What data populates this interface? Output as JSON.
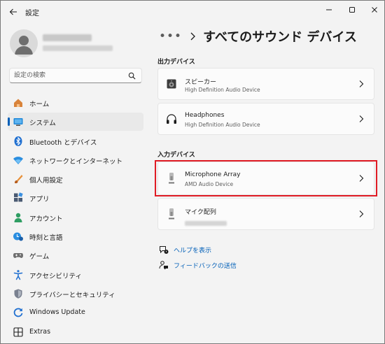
{
  "window": {
    "title": "設定",
    "controls": [
      "minimize-icon",
      "maximize-icon",
      "close-icon"
    ]
  },
  "profile": {
    "name": "",
    "email": ""
  },
  "search": {
    "placeholder": "設定の検索",
    "value": ""
  },
  "sidebar": {
    "items": [
      {
        "label": "ホーム",
        "icon": "home-icon",
        "selected": false
      },
      {
        "label": "システム",
        "icon": "system-icon",
        "selected": true
      },
      {
        "label": "Bluetooth とデバイス",
        "icon": "bluetooth-icon",
        "selected": false
      },
      {
        "label": "ネットワークとインターネット",
        "icon": "network-icon",
        "selected": false
      },
      {
        "label": "個人用設定",
        "icon": "personalization-icon",
        "selected": false
      },
      {
        "label": "アプリ",
        "icon": "apps-icon",
        "selected": false
      },
      {
        "label": "アカウント",
        "icon": "accounts-icon",
        "selected": false
      },
      {
        "label": "時刻と言語",
        "icon": "time-language-icon",
        "selected": false
      },
      {
        "label": "ゲーム",
        "icon": "gaming-icon",
        "selected": false
      },
      {
        "label": "アクセシビリティ",
        "icon": "accessibility-icon",
        "selected": false
      },
      {
        "label": "プライバシーとセキュリティ",
        "icon": "privacy-icon",
        "selected": false
      },
      {
        "label": "Windows Update",
        "icon": "windows-update-icon",
        "selected": false
      },
      {
        "label": "Extras",
        "icon": "extras-icon",
        "selected": false
      }
    ]
  },
  "breadcrumb": {
    "ellipsis": "•••",
    "title": "すべてのサウンド デバイス"
  },
  "output": {
    "label": "出力デバイス",
    "devices": [
      {
        "name": "スピーカー",
        "sub": "High Definition Audio Device",
        "icon": "speaker-icon"
      },
      {
        "name": "Headphones",
        "sub": "High Definition Audio Device",
        "icon": "headphones-icon"
      }
    ]
  },
  "input": {
    "label": "入力デバイス",
    "devices": [
      {
        "name": "Microphone Array",
        "sub": "AMD Audio Device",
        "icon": "microphone-icon"
      },
      {
        "name": "マイク配列",
        "sub": "",
        "icon": "microphone-icon"
      }
    ]
  },
  "links": {
    "help": "ヘルプを表示",
    "feedback": "フィードバックの送信"
  },
  "colors": {
    "accent": "#005fb8",
    "highlight": "#e01b24",
    "background": "#f3f3f3"
  }
}
